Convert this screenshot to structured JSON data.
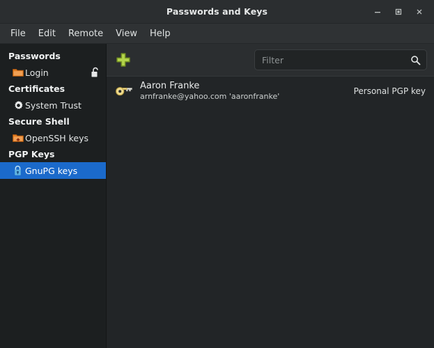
{
  "window": {
    "title": "Passwords and Keys",
    "controls": [
      {
        "name": "minimize-button",
        "glyph": "minimize"
      },
      {
        "name": "maximize-button",
        "glyph": "maximize"
      },
      {
        "name": "close-button",
        "glyph": "close"
      }
    ]
  },
  "menubar": {
    "items": [
      {
        "label": "File"
      },
      {
        "label": "Edit"
      },
      {
        "label": "Remote"
      },
      {
        "label": "View"
      },
      {
        "label": "Help"
      }
    ]
  },
  "sidebar": {
    "groups": [
      {
        "header": "Passwords",
        "rows": [
          {
            "label": "Login",
            "icon": "folder-icon",
            "trailing_icon": "unlock-icon",
            "selected": false
          }
        ]
      },
      {
        "header": "Certificates",
        "rows": [
          {
            "label": "System Trust",
            "icon": "gear-icon",
            "trailing_icon": null,
            "selected": false
          }
        ]
      },
      {
        "header": "Secure Shell",
        "rows": [
          {
            "label": "OpenSSH keys",
            "icon": "folder-ssh-icon",
            "trailing_icon": null,
            "selected": false
          }
        ]
      },
      {
        "header": "PGP Keys",
        "rows": [
          {
            "label": "GnuPG keys",
            "icon": "lock-key-icon",
            "trailing_icon": null,
            "selected": true
          }
        ]
      }
    ]
  },
  "toolbar": {
    "add_button_name": "add-key-button",
    "add_icon": "plus-icon",
    "filter": {
      "placeholder": "Filter",
      "value": "",
      "icon": "search-icon"
    }
  },
  "keylist": {
    "rows": [
      {
        "icon": "key-icon",
        "title": "Aaron Franke",
        "subtitle": "arnfranke@yahoo.com 'aaronfranke'",
        "meta": "Personal PGP key"
      }
    ]
  },
  "colors": {
    "titlebar_bg": "#2b2e30",
    "menubar_bg": "#2f3234",
    "sidebar_bg": "#1c1f20",
    "main_bg": "#2b2e30",
    "list_bg": "#222527",
    "selection_blue": "#1b6acb",
    "plus_green": "#a4c639",
    "key_gold": "#e8d27a",
    "folder_orange": "#e08020"
  }
}
